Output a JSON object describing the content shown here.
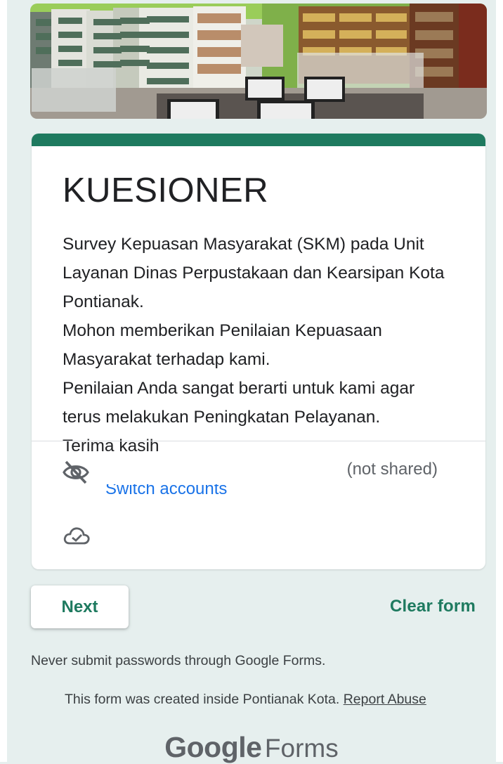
{
  "banner": {
    "image_alt": "library-reading-room-photo"
  },
  "form": {
    "title": "KUESIONER",
    "description_lines": [
      "Survey Kepuasan Masyarakat (SKM) pada Unit",
      "Layanan Dinas Perpustakaan dan Kearsipan Kota",
      "Pontianak.",
      "Mohon memberikan Penilaian Kepuasaan",
      "Masyarakat terhadap kami.",
      "Penilaian Anda sangat berarti untuk kami agar",
      "terus melakukan Peningkatan Pelayanan.",
      "Terima kasih"
    ],
    "account": {
      "status": "(not shared)",
      "switch_label": "Switch accounts",
      "hidden_icon": "eye-off-icon",
      "saved_icon": "cloud-check-icon"
    },
    "theme_color": "#1e7a5f"
  },
  "actions": {
    "next_label": "Next",
    "clear_label": "Clear form"
  },
  "footer": {
    "warning": "Never submit passwords through Google Forms.",
    "created_text": "This form was created inside Pontianak Kota.",
    "report_label": "Report Abuse",
    "brand_google": "Google",
    "brand_forms": "Forms"
  }
}
